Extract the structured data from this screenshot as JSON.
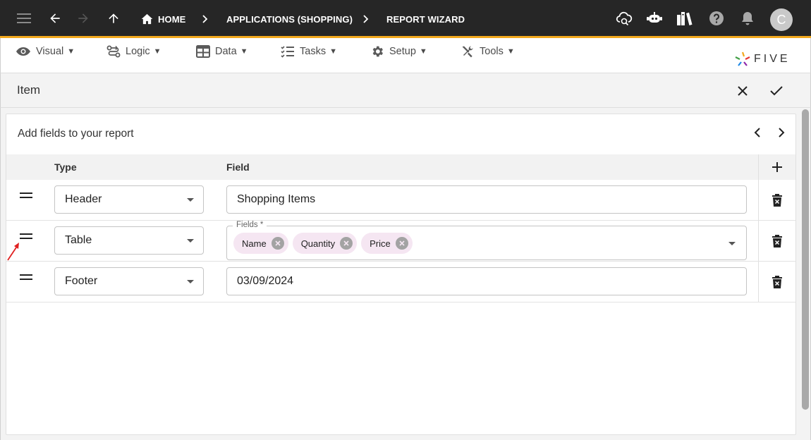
{
  "topbar": {
    "breadcrumb_home": "HOME",
    "breadcrumb_app": "APPLICATIONS (SHOPPING)",
    "breadcrumb_current": "REPORT WIZARD",
    "avatar_initial": "C",
    "accent_color": "#f2a81d"
  },
  "menubar": {
    "items": [
      {
        "label": "Visual",
        "icon": "eye-icon"
      },
      {
        "label": "Logic",
        "icon": "logic-flow-icon"
      },
      {
        "label": "Data",
        "icon": "table-grid-icon"
      },
      {
        "label": "Tasks",
        "icon": "checklist-icon"
      },
      {
        "label": "Setup",
        "icon": "gear-icon"
      },
      {
        "label": "Tools",
        "icon": "tools-icon"
      }
    ],
    "caret": "▼",
    "logo_text": "FIVE"
  },
  "item_header": {
    "title": "Item"
  },
  "wizard": {
    "title": "Add fields to your report",
    "columns": {
      "type": "Type",
      "field": "Field"
    },
    "rows": [
      {
        "type": "Header",
        "field_value": "Shopping Items"
      },
      {
        "type": "Table",
        "field_label": "Fields *",
        "chips": [
          "Name",
          "Quantity",
          "Price"
        ]
      },
      {
        "type": "Footer",
        "field_value": "03/09/2024"
      }
    ]
  }
}
